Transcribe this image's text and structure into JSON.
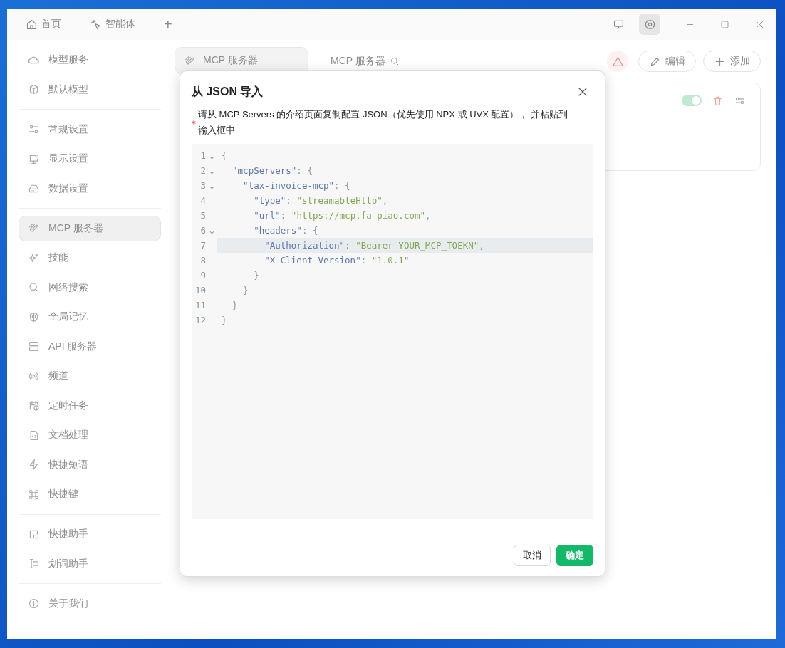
{
  "tabs": [
    {
      "label": "首页"
    },
    {
      "label": "智能体"
    }
  ],
  "add_tab": {
    "label": "+"
  },
  "title_bar_buttons": [
    {
      "selected": false
    },
    {
      "selected": true
    }
  ],
  "sidebar": {
    "groups": [
      {
        "items": [
          {
            "label": "模型服务",
            "selected": false
          },
          {
            "label": "默认模型",
            "selected": false
          }
        ]
      },
      {
        "items": [
          {
            "label": "常规设置",
            "selected": false
          },
          {
            "label": "显示设置",
            "selected": false
          },
          {
            "label": "数据设置",
            "selected": false
          }
        ]
      },
      {
        "items": [
          {
            "label": "MCP 服务器",
            "selected": true
          },
          {
            "label": "技能",
            "selected": false
          },
          {
            "label": "网络搜索",
            "selected": false
          },
          {
            "label": "全局记忆",
            "selected": false
          },
          {
            "label": "API 服务器",
            "selected": false
          },
          {
            "label": "频道",
            "selected": false
          },
          {
            "label": "定时任务",
            "selected": false
          },
          {
            "label": "文档处理",
            "selected": false
          },
          {
            "label": "快捷短语",
            "selected": false
          },
          {
            "label": "快捷键",
            "selected": false
          }
        ]
      },
      {
        "items": [
          {
            "label": "快捷助手",
            "selected": false
          },
          {
            "label": "划词助手",
            "selected": false
          }
        ]
      },
      {
        "items": [
          {
            "label": "关于我们",
            "selected": false
          }
        ]
      }
    ]
  },
  "middle_column": {
    "items": [
      {
        "label": "MCP 服务器",
        "selected": true
      }
    ]
  },
  "panel": {
    "title": "MCP 服务器",
    "buttons": [
      {
        "label": "编辑"
      },
      {
        "label": "添加"
      }
    ],
    "server_card": {
      "enabled": true
    }
  },
  "dialog": {
    "title": "从 JSON 导入",
    "required": true,
    "label": "请从 MCP Servers 的介绍页面复制配置 JSON（优先使用 NPX 或 UVX 配置）， 并粘贴到输入框中",
    "code_lines": [
      {
        "number": "1",
        "foldable": true,
        "highlighted": false,
        "tokens": [
          {
            "kind": "punct",
            "text": "{"
          }
        ]
      },
      {
        "number": "2",
        "foldable": true,
        "highlighted": false,
        "tokens": [
          {
            "kind": "key",
            "text": "  \"mcpServers\""
          },
          {
            "kind": "punct",
            "text": ": {"
          }
        ]
      },
      {
        "number": "3",
        "foldable": true,
        "highlighted": false,
        "tokens": [
          {
            "kind": "key",
            "text": "    \"tax-invoice-mcp\""
          },
          {
            "kind": "punct",
            "text": ": {"
          }
        ]
      },
      {
        "number": "4",
        "foldable": false,
        "highlighted": false,
        "tokens": [
          {
            "kind": "key",
            "text": "      \"type\""
          },
          {
            "kind": "punct",
            "text": ": "
          },
          {
            "kind": "string",
            "text": "\"streamableHttp\""
          },
          {
            "kind": "punct",
            "text": ","
          }
        ]
      },
      {
        "number": "5",
        "foldable": false,
        "highlighted": false,
        "tokens": [
          {
            "kind": "key",
            "text": "      \"url\""
          },
          {
            "kind": "punct",
            "text": ": "
          },
          {
            "kind": "string",
            "text": "\"https://mcp.fa-piao.com\""
          },
          {
            "kind": "punct",
            "text": ","
          }
        ]
      },
      {
        "number": "6",
        "foldable": true,
        "highlighted": false,
        "tokens": [
          {
            "kind": "key",
            "text": "      \"headers\""
          },
          {
            "kind": "punct",
            "text": ": {"
          }
        ]
      },
      {
        "number": "7",
        "foldable": false,
        "highlighted": true,
        "tokens": [
          {
            "kind": "key",
            "text": "        \"Authorization\""
          },
          {
            "kind": "punct",
            "text": ": "
          },
          {
            "kind": "string",
            "text": "\"Bearer YOUR_MCP_TOEKN\""
          },
          {
            "kind": "punct",
            "text": ","
          }
        ]
      },
      {
        "number": "8",
        "foldable": false,
        "highlighted": false,
        "tokens": [
          {
            "kind": "key",
            "text": "        \"X-Client-Version\""
          },
          {
            "kind": "punct",
            "text": ": "
          },
          {
            "kind": "string",
            "text": "\"1.0.1\""
          }
        ]
      },
      {
        "number": "9",
        "foldable": false,
        "highlighted": false,
        "tokens": [
          {
            "kind": "punct",
            "text": "      }"
          }
        ]
      },
      {
        "number": "10",
        "foldable": false,
        "highlighted": false,
        "tokens": [
          {
            "kind": "punct",
            "text": "    }"
          }
        ]
      },
      {
        "number": "11",
        "foldable": false,
        "highlighted": false,
        "tokens": [
          {
            "kind": "punct",
            "text": "  }"
          }
        ]
      },
      {
        "number": "12",
        "foldable": false,
        "highlighted": false,
        "tokens": [
          {
            "kind": "punct",
            "text": "}"
          }
        ]
      }
    ],
    "buttons": [
      {
        "label": "取消",
        "kind": "secondary"
      },
      {
        "label": "确定",
        "kind": "primary"
      }
    ]
  }
}
